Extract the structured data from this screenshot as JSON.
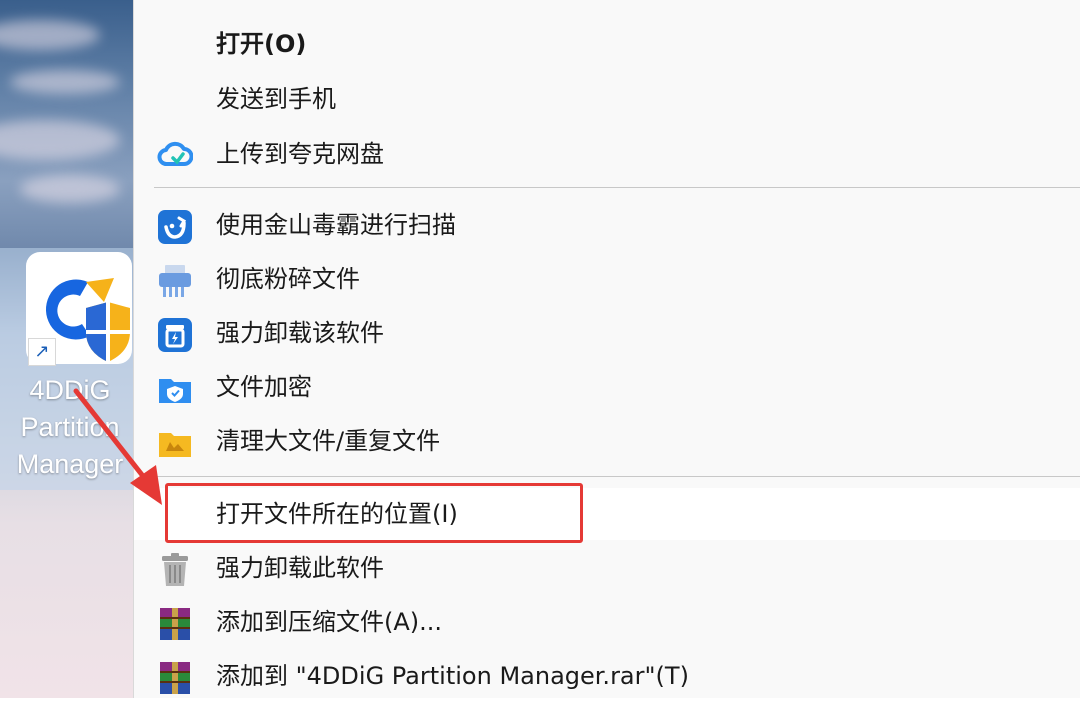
{
  "desktop": {
    "icon_name": "4DDiG Partition Manager shortcut",
    "label_lines": [
      "4DDiG",
      "Partition",
      "Manager"
    ]
  },
  "menu": {
    "items": [
      {
        "label": "打开(O)",
        "icon": "none"
      },
      {
        "label": "发送到手机",
        "icon": "none"
      },
      {
        "label": "上传到夸克网盘",
        "icon": "cloud-icon"
      },
      {
        "label": "使用金山毒霸进行扫描",
        "icon": "duba-shield-icon"
      },
      {
        "label": "彻底粉碎文件",
        "icon": "shredder-icon"
      },
      {
        "label": "强力卸载该软件",
        "icon": "uninstall-icon"
      },
      {
        "label": "文件加密",
        "icon": "folder-lock-icon"
      },
      {
        "label": "清理大文件/重复文件",
        "icon": "folder-clean-icon"
      },
      {
        "label": "打开文件所在的位置(I)",
        "icon": "none"
      },
      {
        "label": "强力卸载此软件",
        "icon": "trash-icon"
      },
      {
        "label": "添加到压缩文件(A)...",
        "icon": "winrar-icon"
      },
      {
        "label": "添加到 \"4DDiG Partition Manager.rar\"(T)",
        "icon": "winrar-icon"
      }
    ]
  },
  "annotation": {
    "highlight_color": "#e53935"
  }
}
